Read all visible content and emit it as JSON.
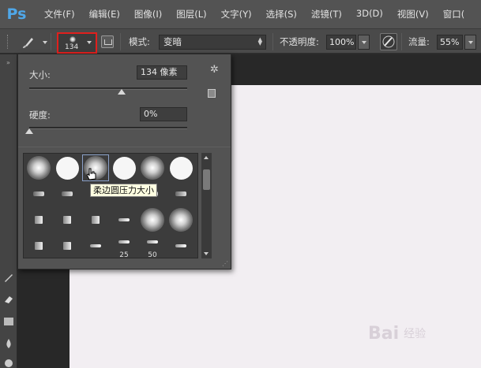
{
  "app": {
    "logo": "Ps"
  },
  "menu": [
    "文件(F)",
    "编辑(E)",
    "图像(I)",
    "图层(L)",
    "文字(Y)",
    "选择(S)",
    "滤镜(T)",
    "3D(D)",
    "视图(V)",
    "窗口("
  ],
  "options_bar": {
    "brush_size": "134",
    "mode_label": "模式:",
    "mode_value": "变暗",
    "opacity_label": "不透明度:",
    "opacity_value": "100%",
    "flow_label": "流量:",
    "flow_value": "55%"
  },
  "brush_panel": {
    "size_label": "大小:",
    "size_value": "134 像素",
    "size_slider_fraction": 0.5,
    "hardness_label": "硬度:",
    "hardness_value": "0%",
    "hardness_slider_fraction": 0.0,
    "presets": [
      {
        "kind": "soft"
      },
      {
        "kind": "hard"
      },
      {
        "kind": "soft",
        "selected": true
      },
      {
        "kind": "hard"
      },
      {
        "kind": "soft"
      },
      {
        "kind": "hard"
      },
      {
        "kind": "tiny"
      },
      {
        "kind": "tiny"
      },
      {
        "kind": "tiny"
      },
      {
        "kind": "tiny"
      },
      {
        "kind": "tiny"
      },
      {
        "kind": "tiny"
      },
      {
        "kind": "tiny-b"
      },
      {
        "kind": "tiny-b"
      },
      {
        "kind": "tiny-b"
      },
      {
        "kind": "tiny-c"
      },
      {
        "kind": "soft"
      },
      {
        "kind": "soft"
      },
      {
        "kind": "tiny-b"
      },
      {
        "kind": "tiny-b"
      },
      {
        "kind": "tiny-c"
      },
      {
        "kind": "tiny-c",
        "num": "25"
      },
      {
        "kind": "tiny-c",
        "num": "50"
      },
      {
        "kind": "tiny-c"
      }
    ],
    "tooltip": "柔边圆压力大小"
  },
  "watermark": {
    "text": "Bai",
    "sub": "经验"
  },
  "colors": {
    "accent_highlight": "#e0201d",
    "canvas": "#f2eef2"
  }
}
